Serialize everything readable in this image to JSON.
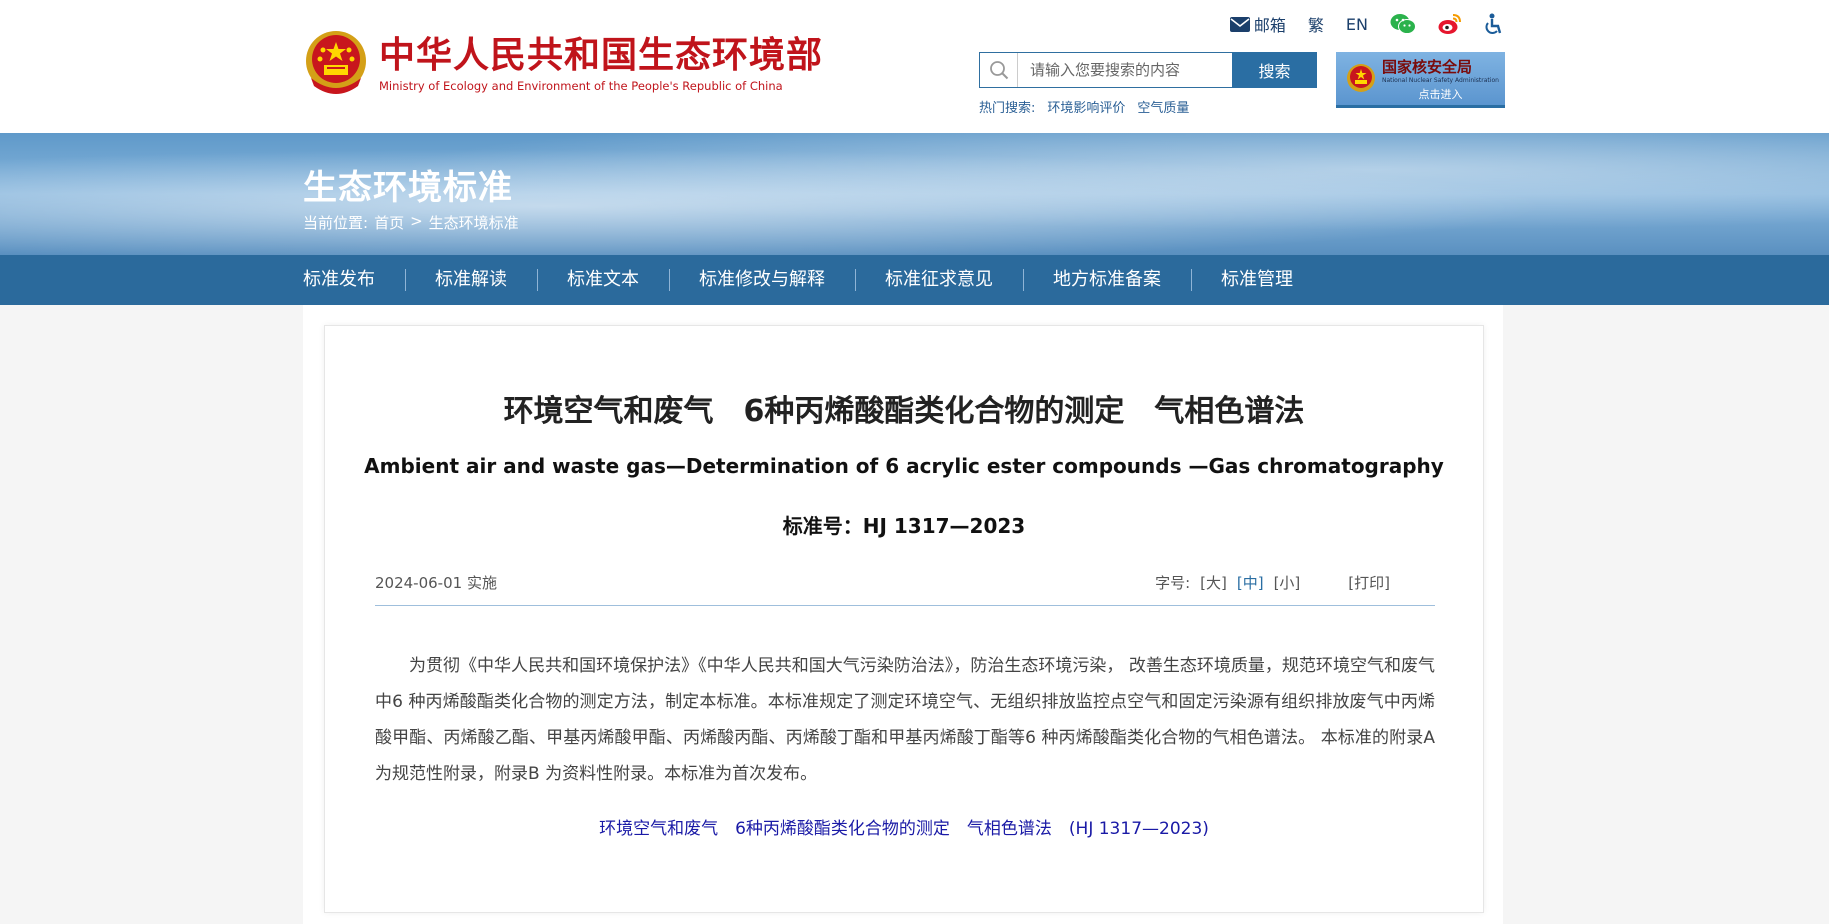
{
  "header": {
    "logo_cn": "中华人民共和国生态环境部",
    "logo_en": "Ministry of Ecology and Environment of the People's Republic of China",
    "top_links": {
      "mail": "邮箱",
      "traditional": "繁",
      "english": "EN"
    },
    "search": {
      "placeholder": "请输入您要搜索的内容",
      "button": "搜索"
    },
    "hot_search": {
      "label": "热门搜索:",
      "items": [
        "环境影响评价",
        "空气质量"
      ]
    },
    "nnsa": {
      "cn": "国家核安全局",
      "en": "National Nuclear Safety Administration",
      "enter": "点击进入"
    }
  },
  "banner": {
    "title": "生态环境标准",
    "breadcrumb": {
      "label": "当前位置:",
      "home": "首页",
      "sep": ">",
      "current": "生态环境标准"
    }
  },
  "nav": {
    "items": [
      "标准发布",
      "标准解读",
      "标准文本",
      "标准修改与解释",
      "标准征求意见",
      "地方标准备案",
      "标准管理"
    ]
  },
  "article": {
    "title": "环境空气和废气　6种丙烯酸酯类化合物的测定　气相色谱法",
    "subtitle": "Ambient air and waste gas—Determination of 6 acrylic ester compounds —Gas chromatography",
    "std_no": "标准号：HJ 1317—2023",
    "date": "2024-06-01 实施",
    "font_label": "字号:",
    "font_large": "[大]",
    "font_medium": "[中]",
    "font_small": "[小]",
    "print": "[打印]",
    "body": "为贯彻《中华人民共和国环境保护法》《中华人民共和国大气污染防治法》，防治生态环境污染， 改善生态环境质量，规范环境空气和废气中6 种丙烯酸酯类化合物的测定方法，制定本标准。本标准规定了测定环境空气、无组织排放监控点空气和固定污染源有组织排放废气中丙烯酸甲酯、丙烯酸乙酯、甲基丙烯酸甲酯、丙烯酸丙酯、丙烯酸丁酯和甲基丙烯酸丁酯等6 种丙烯酸酯类化合物的气相色谱法。 本标准的附录A 为规范性附录，附录B 为资料性附录。本标准为首次发布。",
    "link": "环境空气和废气　6种丙烯酸酯类化合物的测定　气相色谱法　(HJ 1317—2023)"
  },
  "colors": {
    "brand_red": "#c0141b",
    "nav_blue": "#2b6a9c",
    "link_blue": "#1a1aa6"
  }
}
